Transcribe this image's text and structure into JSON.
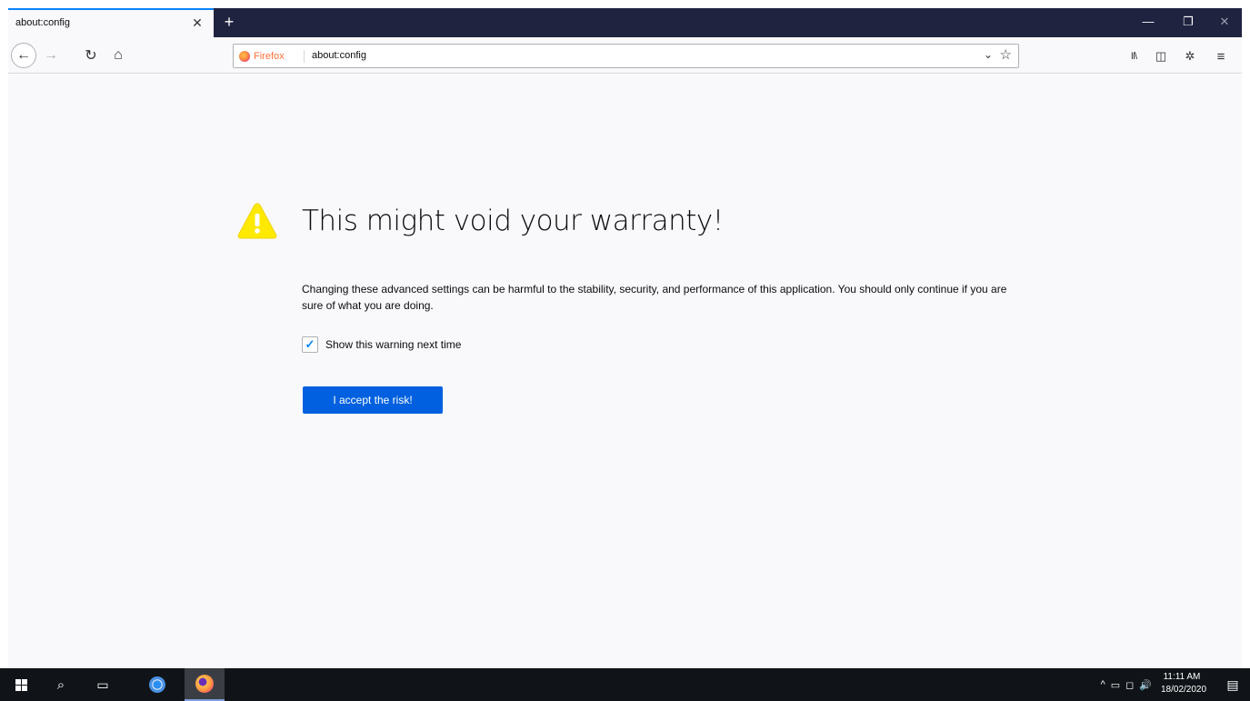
{
  "tab": {
    "title": "about:config",
    "close": "✕"
  },
  "newtab": "+",
  "window_controls": {
    "minimize": "—",
    "maximize": "❐",
    "close": "✕"
  },
  "nav": {
    "back": "←",
    "forward": "→",
    "reload": "↻",
    "home": "⌂"
  },
  "urlbar": {
    "identity": "Firefox",
    "url": "about:config",
    "dropdown": "⌄",
    "star": "☆"
  },
  "toolbar": {
    "library": "II\\",
    "sidebar": "◫",
    "extension": "✲",
    "menu": "≡"
  },
  "warning": {
    "title": "This might void your warranty!",
    "description": "Changing these advanced settings can be harmful to the stability, security, and performance of this application. You should only continue if you are sure of what you are doing.",
    "checkbox_label": "Show this warning next time",
    "checkbox_checked": true,
    "checkbox_mark": "✓",
    "accept_button": "I accept the risk!"
  },
  "taskbar": {
    "search": "⌕",
    "taskview": "▭",
    "tray_chevron": "^",
    "tray_network": "▭",
    "tray_display": "◻",
    "tray_volume": "🔊",
    "time": "11:11 AM",
    "date": "18/02/2020",
    "notifications": "▤"
  },
  "colors": {
    "accent": "#0a84ff",
    "button": "#0060df",
    "warning": "#ffe900",
    "tabstrip": "#202340",
    "taskbar": "#101418"
  }
}
